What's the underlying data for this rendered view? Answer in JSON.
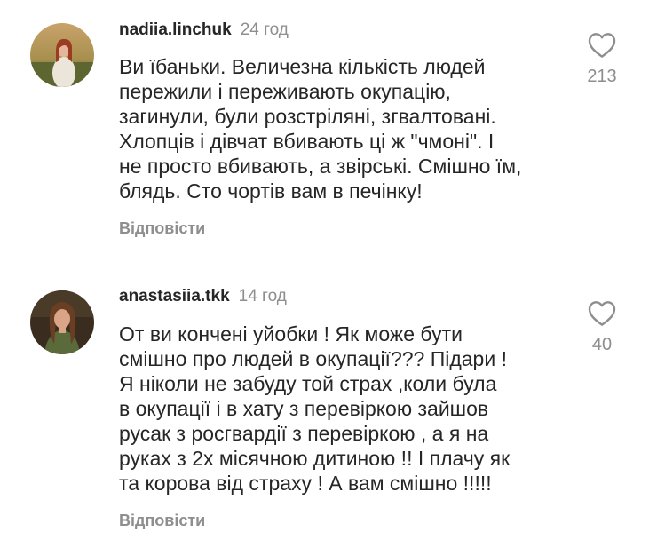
{
  "comments": [
    {
      "username": "nadiia.linchuk",
      "time": "24 год",
      "text": "Ви їбаньки. Величезна кількість людей\nпережили і переживають окупацію,\nзагинули, були розстріляні, згвалтовані.\nХлопців і дівчат вбивають ці ж \"чмоні\". І\nне просто вбивають, а звірські. Смішно їм,\nблядь. Сто чортів вам в печінку!",
      "reply": "Відповісти",
      "likes": "213"
    },
    {
      "username": "anastasiia.tkk",
      "time": "14 год",
      "text": "От ви кончені уйобки ! Як може бути\nсмішно про людей в окупації??? Підари !\nЯ ніколи не забуду той страх ,коли була\nв окупації і в хату з перевіркою зайшов\nрусак з росгвардії з перевіркою , а я на\nруках з 2х місячною дитиною !! І плачу як\nта корова від страху ! А вам смішно !!!!!",
      "reply": "Відповісти",
      "likes": "40"
    }
  ],
  "icons": {
    "like": "heart-outline-icon"
  }
}
